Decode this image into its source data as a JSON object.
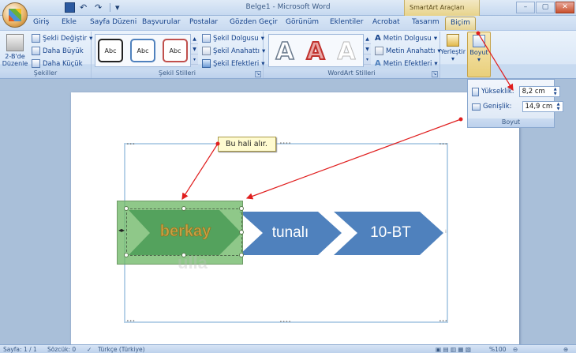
{
  "window": {
    "title": "Belge1 - Microsoft Word",
    "context_tab_title": "SmartArt Araçları"
  },
  "tabs": [
    {
      "label": "Giriş"
    },
    {
      "label": "Ekle"
    },
    {
      "label": "Sayfa Düzeni"
    },
    {
      "label": "Başvurular"
    },
    {
      "label": "Postalar"
    },
    {
      "label": "Gözden Geçir"
    },
    {
      "label": "Görünüm"
    },
    {
      "label": "Eklentiler"
    },
    {
      "label": "Acrobat"
    },
    {
      "label": "Tasarım"
    },
    {
      "label": "Biçim"
    }
  ],
  "ribbon": {
    "sekiller": {
      "label": "Şekiller",
      "edit_2d_line1": "2-B'de",
      "edit_2d_line2": "Düzenle",
      "change_shape": "Şekli Değiştir",
      "larger": "Daha Büyük",
      "smaller": "Daha Küçük"
    },
    "sekil_stilleri": {
      "label": "Şekil Stilleri",
      "styles": [
        "Abc",
        "Abc",
        "Abc"
      ],
      "fill": "Şekil Dolgusu",
      "outline": "Şekil Anahattı",
      "effects": "Şekil Efektleri"
    },
    "wordart": {
      "label": "WordArt Stilleri",
      "letters": [
        "A",
        "A",
        "A"
      ],
      "text_fill": "Metin Dolgusu",
      "text_outline": "Metin Anahattı",
      "text_effects": "Metin Efektleri"
    },
    "arrange": {
      "label": "Yerleştir"
    },
    "size": {
      "label": "Boyut"
    }
  },
  "size_panel": {
    "height_label": "Yükseklik:",
    "height_value": "8,2 cm",
    "width_label": "Genişlik:",
    "width_value": "14,9 cm",
    "group_label": "Boyut"
  },
  "smartart": {
    "items": [
      "berkay",
      "tunalı",
      "10-BT"
    ],
    "selected_fill": "#70b868",
    "chevron_fill": "#4f81bd"
  },
  "callout": {
    "text": "Bu hali alır."
  },
  "watermark": "ulla",
  "statusbar": {
    "page": "Sayfa: 1 / 1",
    "words": "Sözcük: 0",
    "language": "Türkçe (Türkiye)",
    "zoom": "%100"
  },
  "colors": {
    "arrow": "#e01e1e",
    "accent": "#15428b"
  }
}
